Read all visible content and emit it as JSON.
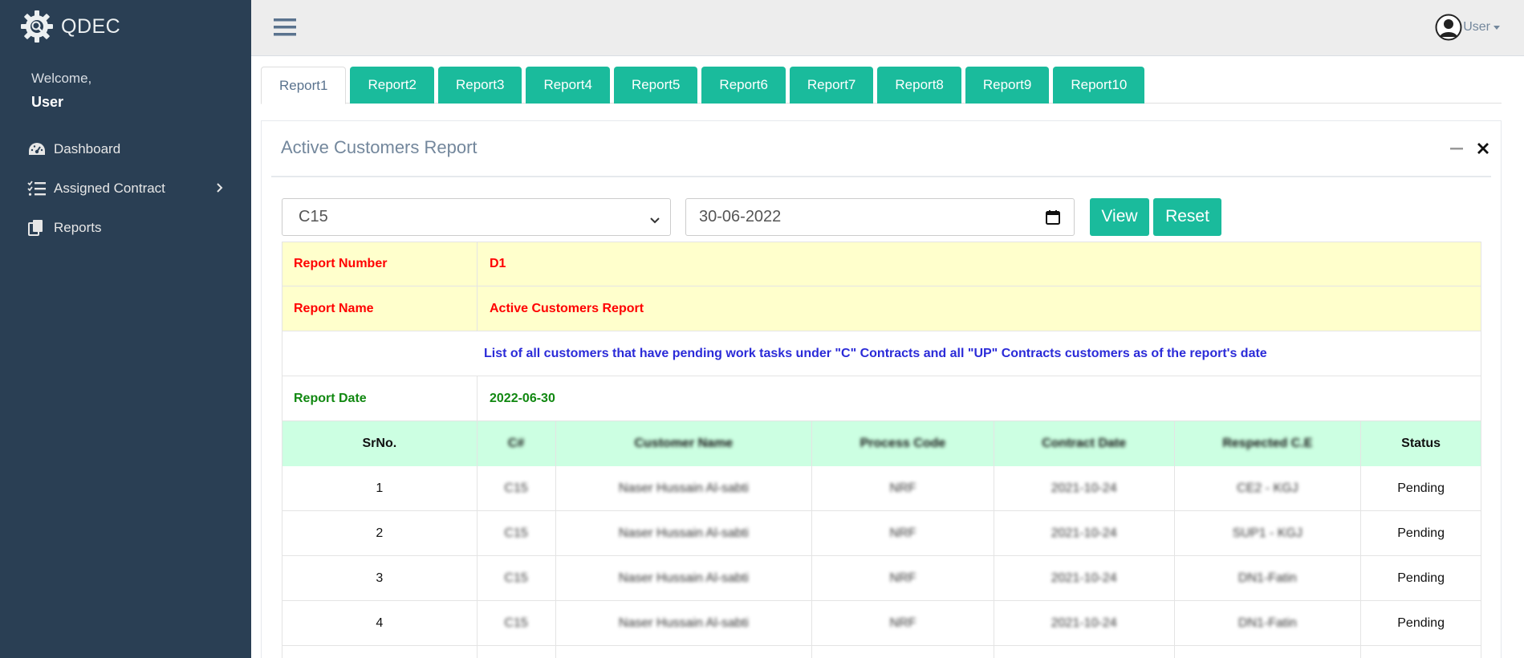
{
  "sidebar": {
    "brand": "QDEC",
    "welcome_label": "Welcome,",
    "welcome_user": "User",
    "items": [
      {
        "label": "Dashboard",
        "icon": "gauge-icon"
      },
      {
        "label": "Assigned Contract",
        "icon": "list-check-icon"
      },
      {
        "label": "Reports",
        "icon": "copy-icon"
      }
    ]
  },
  "topnav": {
    "user_label": "User"
  },
  "tabs": [
    "Report1",
    "Report2",
    "Report3",
    "Report4",
    "Report5",
    "Report6",
    "Report7",
    "Report8",
    "Report9",
    "Report10"
  ],
  "active_tab": "Report1",
  "panel": {
    "title": "Active Customers Report"
  },
  "filters": {
    "contract_value": "C15",
    "date_value": "30-06-2022",
    "view_label": "View",
    "reset_label": "Reset"
  },
  "report_info": {
    "number_label": "Report Number",
    "number_value": "D1",
    "name_label": "Report Name",
    "name_value": "Active Customers Report",
    "description": "List of all customers that have pending work tasks under \"C\" Contracts and all \"UP\" Contracts customers as of the report's date",
    "date_label": "Report Date",
    "date_value": "2022-06-30"
  },
  "table": {
    "headers": {
      "srno": "SrNo.",
      "c": "C#",
      "customer_name": "Customer Name",
      "process_code": "Process Code",
      "contract_date": "Contract Date",
      "respected_ce": "Respected C.E",
      "status": "Status"
    },
    "rows": [
      {
        "srno": "1",
        "c": "C15",
        "name": "Naser Hussain Al-sabti",
        "process": "NRF",
        "date": "2021-10-24",
        "ce": "CE2 - KGJ",
        "status": "Pending"
      },
      {
        "srno": "2",
        "c": "C15",
        "name": "Naser Hussain Al-sabti",
        "process": "NRF",
        "date": "2021-10-24",
        "ce": "SUP1 - KGJ",
        "status": "Pending"
      },
      {
        "srno": "3",
        "c": "C15",
        "name": "Naser Hussain Al-sabti",
        "process": "NRF",
        "date": "2021-10-24",
        "ce": "DN1-Fatin",
        "status": "Pending"
      },
      {
        "srno": "4",
        "c": "C15",
        "name": "Naser Hussain Al-sabti",
        "process": "NRF",
        "date": "2021-10-24",
        "ce": "DN1-Fatin",
        "status": "Pending"
      }
    ]
  },
  "colors": {
    "sidebar_bg": "#2a3f54",
    "accent": "#1abb9c",
    "info_bg": "#ffffcc",
    "header_bg": "#ccffe2",
    "red_text": "#ff0000",
    "blue_text": "#2b2bd8",
    "green_text": "#118811"
  }
}
